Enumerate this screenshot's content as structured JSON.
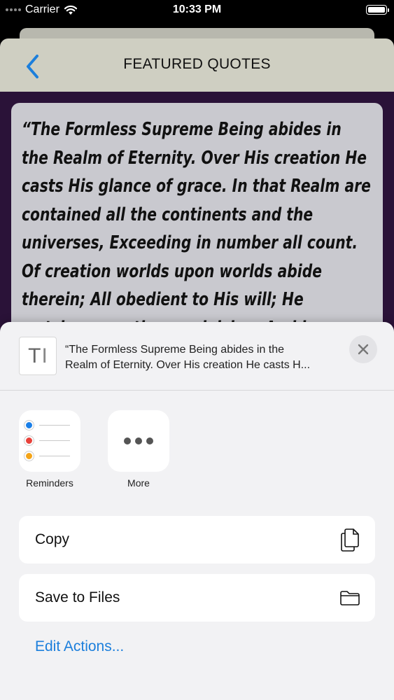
{
  "status_bar": {
    "carrier": "Carrier",
    "time": "10:33 PM",
    "wifi_icon": "wifi-icon",
    "battery_icon": "battery-icon"
  },
  "nav": {
    "title": "FEATURED QUOTES",
    "back_icon": "chevron-left-icon"
  },
  "quote": {
    "text": "“The Formless Supreme Being abides in the Realm of Eternity. Over His creation He casts His glance of grace. In that Realm are contained all the continents and the universes, Exceeding in number all count. Of creation worlds upon worlds abide therein; All obedient to His will; He watches over them, rejoicing. And keeps each constantly"
  },
  "share_sheet": {
    "preview_glyph": "T",
    "preview_text_line1": "“The Formless Supreme Being abides in the",
    "preview_text_line2": "Realm of Eternity. Over His creation He casts H...",
    "apps": [
      {
        "label": "Reminders",
        "icon": "reminders-icon"
      },
      {
        "label": "More",
        "icon": "more-icon"
      }
    ],
    "actions": [
      {
        "label": "Copy",
        "icon": "copy-icon"
      },
      {
        "label": "Save to Files",
        "icon": "folder-icon"
      }
    ],
    "edit_actions": "Edit Actions..."
  },
  "colors": {
    "accent_blue": "#1c7fdc",
    "nav_bg": "#cfcfc2",
    "app_bg": "#2a1238",
    "quote_card_bg": "#c9c9cf",
    "sheet_bg": "#f2f2f4"
  }
}
